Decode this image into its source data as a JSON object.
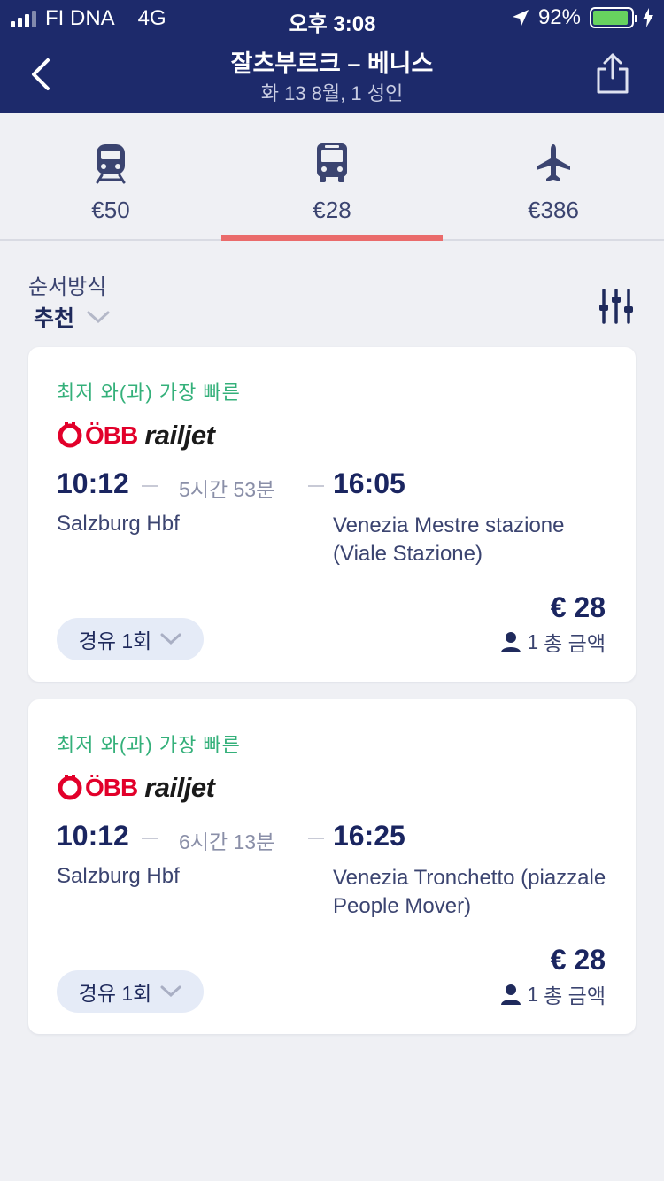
{
  "status_bar": {
    "carrier": "FI DNA",
    "network": "4G",
    "time": "오후 3:08",
    "battery": "92%"
  },
  "nav": {
    "title": "잘츠부르크 – 베니스",
    "subtitle": "화 13 8월, 1 성인"
  },
  "modes": [
    {
      "name": "train",
      "price": "€50"
    },
    {
      "name": "bus",
      "price": "€28"
    },
    {
      "name": "plane",
      "price": "€386"
    }
  ],
  "active_mode": "bus",
  "sort": {
    "label": "순서방식",
    "value": "추천"
  },
  "results": [
    {
      "badge": "최저 와(과) 가장 빠른",
      "operator_mark": "ÖBB",
      "operator_brand": "railjet",
      "departure_time": "10:12",
      "duration": "5시간 53분",
      "arrival_time": "16:05",
      "departure_station": "Salzburg Hbf",
      "arrival_station": "Venezia Mestre stazione (Viale Stazione)",
      "stops": "경유 1회",
      "price": "€ 28",
      "passengers": "1",
      "price_note": "총 금액"
    },
    {
      "badge": "최저 와(과) 가장 빠른",
      "operator_mark": "ÖBB",
      "operator_brand": "railjet",
      "departure_time": "10:12",
      "duration": "6시간 13분",
      "arrival_time": "16:25",
      "departure_station": "Salzburg Hbf",
      "arrival_station": "Venezia Tronchetto (piazzale People Mover)",
      "stops": "경유 1회",
      "price": "€ 28",
      "passengers": "1",
      "price_note": "총 금액"
    }
  ],
  "colors": {
    "header_bg": "#1d2a6b",
    "accent_tab": "#ea6b6b",
    "badge_green": "#34b07a",
    "obb_red": "#e2002a"
  }
}
